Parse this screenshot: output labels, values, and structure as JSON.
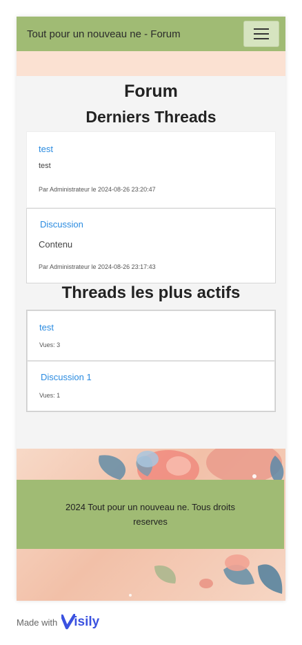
{
  "navbar": {
    "brand": "Tout pour un nouveau ne - Forum",
    "menu_icon": "hamburger-icon"
  },
  "page": {
    "title": "Forum"
  },
  "latest": {
    "heading": "Derniers Threads",
    "threads": [
      {
        "title": "test",
        "content": "test",
        "meta": "Par Administrateur le 2024-08-26 23:20:47"
      },
      {
        "title": "Discussion",
        "content": "Contenu",
        "meta": "Par Administrateur le 2024-08-26 23:17:43"
      }
    ]
  },
  "active": {
    "heading": "Threads les plus actifs",
    "threads": [
      {
        "title": "test",
        "views": "Vues: 3"
      },
      {
        "title": "Discussion 1",
        "views": "Vues: 1"
      }
    ]
  },
  "footer": {
    "text": "2024 Tout pour un nouveau ne. Tous droits reserves"
  },
  "badge": {
    "prefix": "Made with",
    "brand": "isily",
    "icon": "visily-v-icon"
  },
  "colors": {
    "accent_green": "#a0bb74",
    "pink_band": "#fbe1d2",
    "link_blue": "#2a8be0",
    "visily_blue": "#3b52e0"
  }
}
